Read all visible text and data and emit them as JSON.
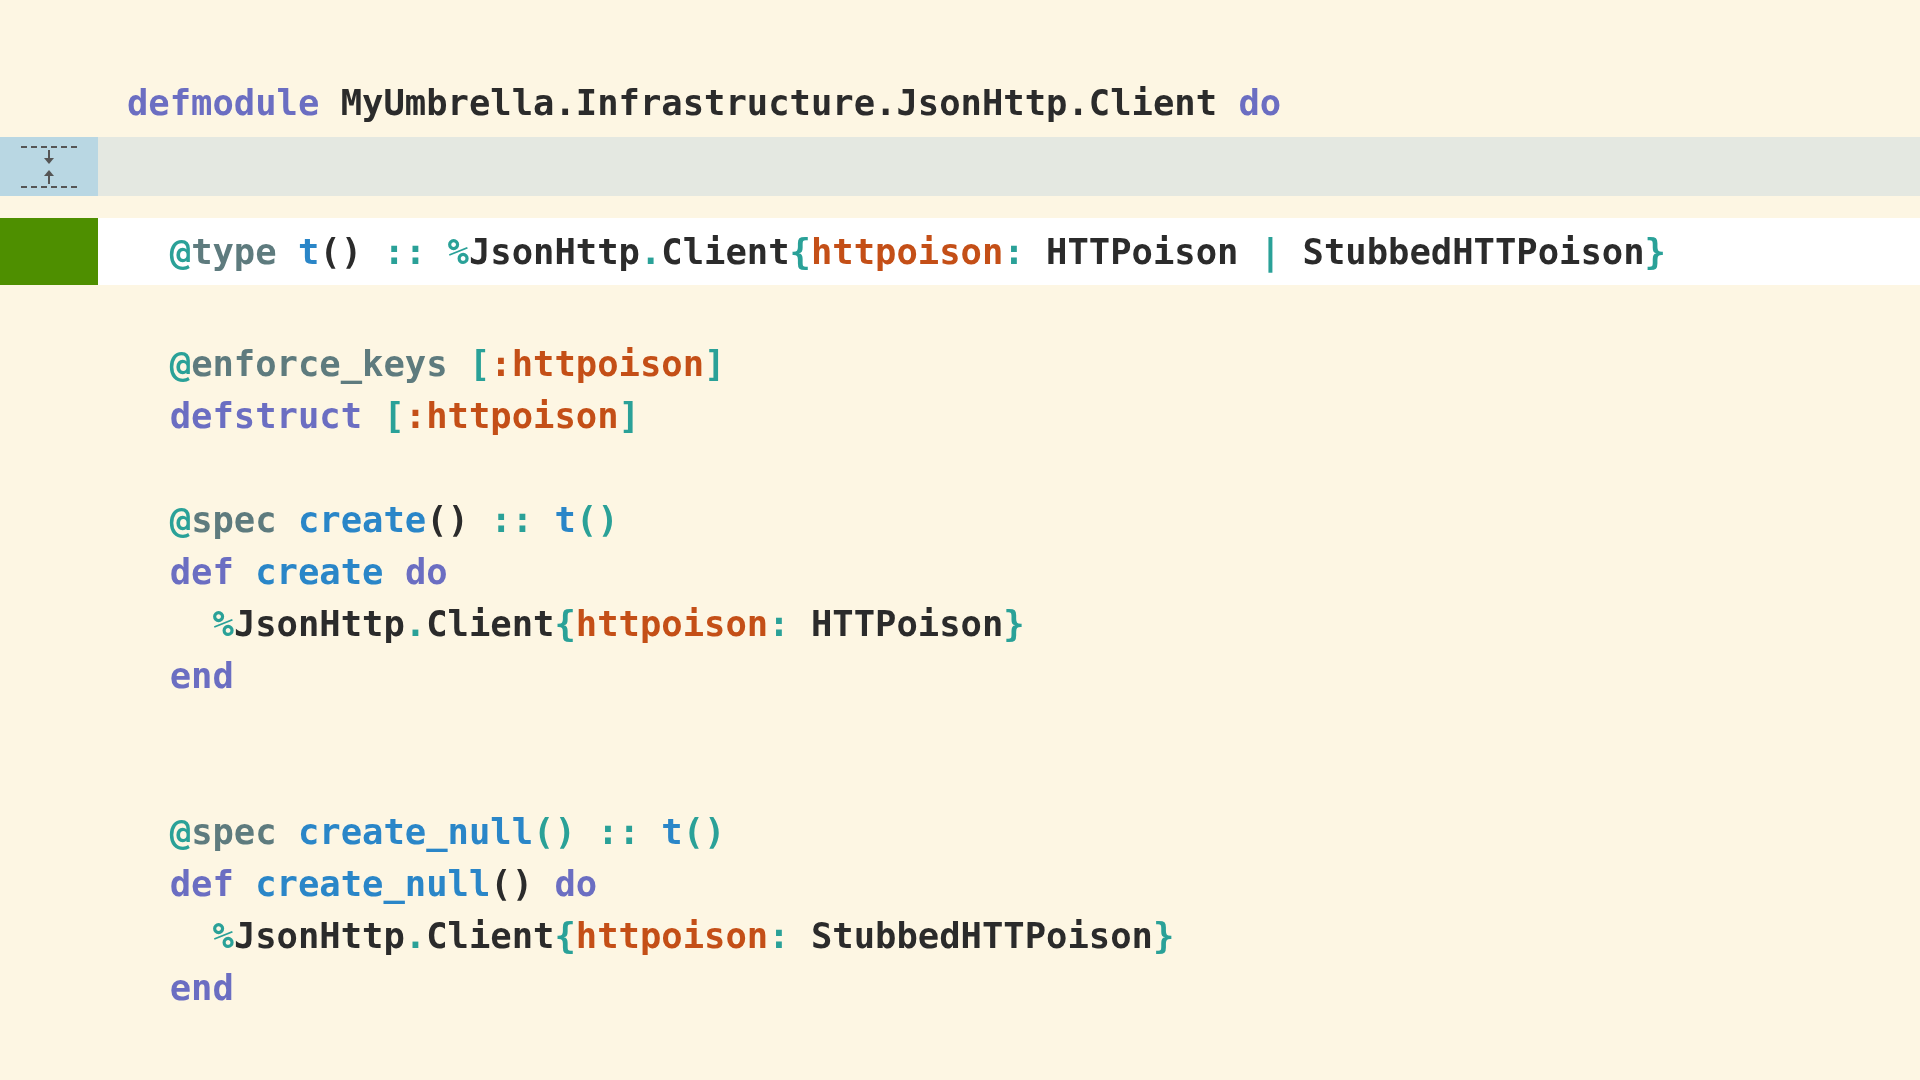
{
  "editor": {
    "lines": [
      {
        "kind": "code",
        "highlighted": false,
        "tokens": [
          {
            "color": "#6b6ec2",
            "text": "defmodule "
          },
          {
            "color": "#2b2b2b",
            "text": "MyUmbrella.Infrastructure.JsonHttp.Client "
          },
          {
            "color": "#6b6ec2",
            "text": "do"
          }
        ]
      },
      {
        "kind": "fold"
      },
      {
        "kind": "code",
        "highlighted": true,
        "tokens": [
          {
            "color": "#2aa198",
            "text": "  @"
          },
          {
            "color": "#5e7b7e",
            "text": "type "
          },
          {
            "color": "#2a86c8",
            "text": "t"
          },
          {
            "color": "#2b2b2b",
            "text": "() "
          },
          {
            "color": "#2aa198",
            "text": ":: %"
          },
          {
            "color": "#2b2b2b",
            "text": "JsonHttp"
          },
          {
            "color": "#2aa198",
            "text": "."
          },
          {
            "color": "#2b2b2b",
            "text": "Client"
          },
          {
            "color": "#2aa198",
            "text": "{"
          },
          {
            "color": "#c44f17",
            "text": "httpoison"
          },
          {
            "color": "#2aa198",
            "text": ": "
          },
          {
            "color": "#2b2b2b",
            "text": "HTTPoison "
          },
          {
            "color": "#2aa198",
            "text": "| "
          },
          {
            "color": "#2b2b2b",
            "text": "StubbedHTTPoison"
          },
          {
            "color": "#2aa198",
            "text": "}"
          }
        ]
      },
      {
        "kind": "blank"
      },
      {
        "kind": "code",
        "highlighted": false,
        "tokens": [
          {
            "color": "#2aa198",
            "text": "  @"
          },
          {
            "color": "#5e7b7e",
            "text": "enforce_keys "
          },
          {
            "color": "#2aa198",
            "text": "["
          },
          {
            "color": "#c44f17",
            "text": ":httpoison"
          },
          {
            "color": "#2aa198",
            "text": "]"
          }
        ]
      },
      {
        "kind": "code",
        "highlighted": false,
        "tokens": [
          {
            "color": "#6b6ec2",
            "text": "  defstruct "
          },
          {
            "color": "#2aa198",
            "text": "["
          },
          {
            "color": "#c44f17",
            "text": ":httpoison"
          },
          {
            "color": "#2aa198",
            "text": "]"
          }
        ]
      },
      {
        "kind": "blank"
      },
      {
        "kind": "code",
        "highlighted": false,
        "tokens": [
          {
            "color": "#2aa198",
            "text": "  @"
          },
          {
            "color": "#5e7b7e",
            "text": "spec "
          },
          {
            "color": "#2a86c8",
            "text": "create"
          },
          {
            "color": "#2b2b2b",
            "text": "() "
          },
          {
            "color": "#2aa198",
            "text": ":: "
          },
          {
            "color": "#2a86c8",
            "text": "t"
          },
          {
            "color": "#2aa198",
            "text": "()"
          }
        ]
      },
      {
        "kind": "code",
        "highlighted": false,
        "tokens": [
          {
            "color": "#6b6ec2",
            "text": "  def "
          },
          {
            "color": "#2a86c8",
            "text": "create "
          },
          {
            "color": "#6b6ec2",
            "text": "do"
          }
        ]
      },
      {
        "kind": "code",
        "highlighted": false,
        "tokens": [
          {
            "color": "#2aa198",
            "text": "    %"
          },
          {
            "color": "#2b2b2b",
            "text": "JsonHttp"
          },
          {
            "color": "#2aa198",
            "text": "."
          },
          {
            "color": "#2b2b2b",
            "text": "Client"
          },
          {
            "color": "#2aa198",
            "text": "{"
          },
          {
            "color": "#c44f17",
            "text": "httpoison"
          },
          {
            "color": "#2aa198",
            "text": ": "
          },
          {
            "color": "#2b2b2b",
            "text": "HTTPoison"
          },
          {
            "color": "#2aa198",
            "text": "}"
          }
        ]
      },
      {
        "kind": "code",
        "highlighted": false,
        "tokens": [
          {
            "color": "#6b6ec2",
            "text": "  end"
          }
        ]
      },
      {
        "kind": "blank"
      },
      {
        "kind": "blank"
      },
      {
        "kind": "code",
        "highlighted": false,
        "tokens": [
          {
            "color": "#2aa198",
            "text": "  @"
          },
          {
            "color": "#5e7b7e",
            "text": "spec "
          },
          {
            "color": "#2a86c8",
            "text": "create_null"
          },
          {
            "color": "#2aa198",
            "text": "() :: "
          },
          {
            "color": "#2a86c8",
            "text": "t"
          },
          {
            "color": "#2aa198",
            "text": "()"
          }
        ]
      },
      {
        "kind": "code",
        "highlighted": false,
        "tokens": [
          {
            "color": "#6b6ec2",
            "text": "  def "
          },
          {
            "color": "#2a86c8",
            "text": "create_null"
          },
          {
            "color": "#2b2b2b",
            "text": "() "
          },
          {
            "color": "#6b6ec2",
            "text": "do"
          }
        ]
      },
      {
        "kind": "code",
        "highlighted": false,
        "tokens": [
          {
            "color": "#2aa198",
            "text": "    %"
          },
          {
            "color": "#2b2b2b",
            "text": "JsonHttp"
          },
          {
            "color": "#2aa198",
            "text": "."
          },
          {
            "color": "#2b2b2b",
            "text": "Client"
          },
          {
            "color": "#2aa198",
            "text": "{"
          },
          {
            "color": "#c44f17",
            "text": "httpoison"
          },
          {
            "color": "#2aa198",
            "text": ": "
          },
          {
            "color": "#2b2b2b",
            "text": "StubbedHTTPoison"
          },
          {
            "color": "#2aa198",
            "text": "}"
          }
        ]
      },
      {
        "kind": "code",
        "highlighted": false,
        "tokens": [
          {
            "color": "#6b6ec2",
            "text": "  end"
          }
        ]
      }
    ]
  }
}
